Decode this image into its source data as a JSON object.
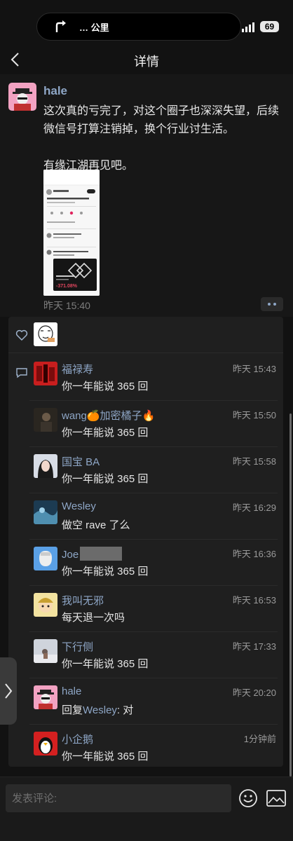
{
  "status_bar": {
    "route_text": "… 公里",
    "battery": "69"
  },
  "nav": {
    "title": "详情"
  },
  "post": {
    "author": "hale",
    "text": "这次真的亏完了，对这个圈子也深深失望，后续微信号打算注销掉，换个行业讨生活。\n\n有缘江湖再见吧。",
    "image": {
      "header": "<   原帖",
      "user": "Eli Hung",
      "line": "亏完了，退圈，再见，再也不见。",
      "card_title": "RAVEUSDT Perpetual",
      "pnl": "-371.08%"
    },
    "time": "昨天 15:40"
  },
  "comments": [
    {
      "name": "福禄寿",
      "time": "昨天 15:43",
      "text": "你一年能说 365 回"
    },
    {
      "name": "wang🍊加密橘子🔥",
      "time": "昨天 15:50",
      "text": "你一年能说 365 回"
    },
    {
      "name": "国宝 BA",
      "time": "昨天 15:58",
      "text": "你一年能说 365 回"
    },
    {
      "name": "Wesley",
      "time": "昨天 16:29",
      "text": "做空 rave 了么"
    },
    {
      "name": "Joe",
      "time": "昨天 16:36",
      "text": "你一年能说 365 回"
    },
    {
      "name": "我叫无邪",
      "time": "昨天 16:53",
      "text": "每天退一次吗"
    },
    {
      "name": "下行侧",
      "time": "昨天 17:33",
      "text": "你一年能说 365 回"
    },
    {
      "name": "hale",
      "time": "昨天 20:20",
      "text": "",
      "reply_prefix": "回复",
      "reply_to": "Wesley",
      "reply_text": ": 对"
    },
    {
      "name": "小企鹅",
      "time": "1分钟前",
      "text": "你一年能说 365 回"
    }
  ],
  "bottom": {
    "placeholder": "发表评论:"
  },
  "colors": {
    "link_blue": "#8ea6c6",
    "background": "#121212",
    "panel": "#1f1f1f"
  },
  "icons": [
    "route-arrow-icon",
    "signal-icon",
    "back-icon",
    "heart-icon",
    "comment-icon",
    "emoji-icon",
    "image-icon",
    "chevron-right-icon",
    "more-icon"
  ]
}
